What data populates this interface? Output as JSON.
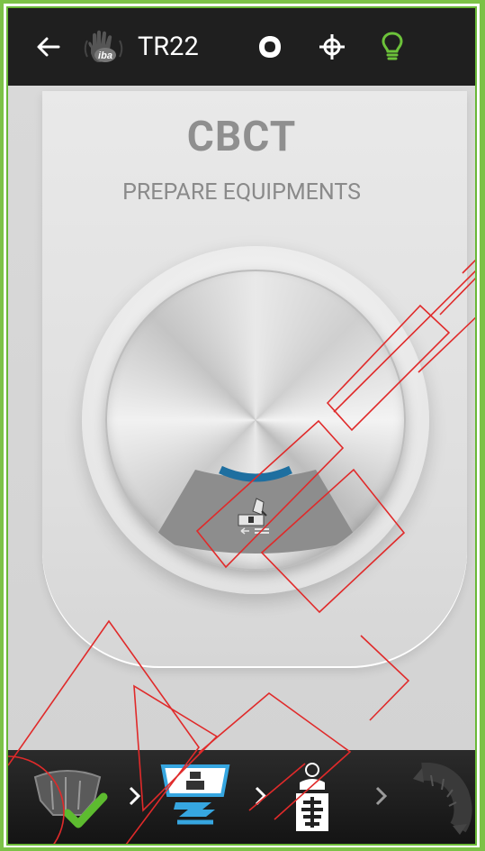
{
  "header": {
    "title": "TR22",
    "logo_text": "iba",
    "accent_color": "#7cc247"
  },
  "main": {
    "heading": "CBCT",
    "subheading": "PREPARE EQUIPMENTS"
  },
  "steps": [
    {
      "name": "gantry-position",
      "state": "done"
    },
    {
      "name": "table-position",
      "state": "active"
    },
    {
      "name": "patient-imaging",
      "state": "pending"
    },
    {
      "name": "gantry-rotation",
      "state": "disabled"
    }
  ],
  "colors": {
    "topbar": "#1f1f1f",
    "progress_arc": "#1e6fa0",
    "check": "#5dbb2f",
    "step_active": "#36a6e0"
  }
}
